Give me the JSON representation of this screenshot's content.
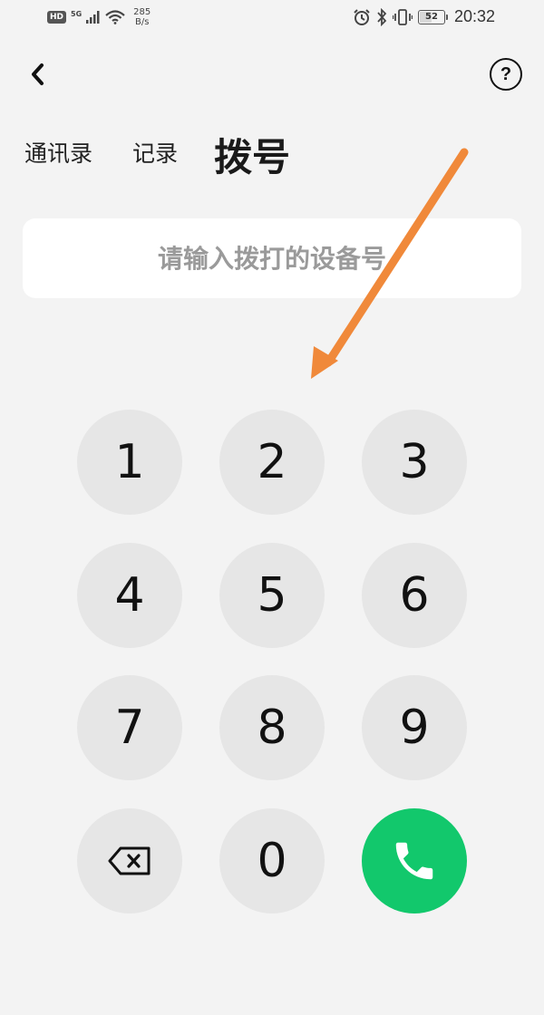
{
  "status_bar": {
    "hd": "HD",
    "network": "5G",
    "speed_value": "285",
    "speed_unit": "B/s",
    "battery_level": "52",
    "battery_fraction": 0.52,
    "time": "20:32",
    "icons": [
      "signal-icon",
      "wifi-icon",
      "alarm-icon",
      "bluetooth-icon",
      "vibrate-icon"
    ]
  },
  "header": {
    "back_icon": "chevron-left-icon",
    "help_label": "?"
  },
  "tabs": [
    {
      "label": "通讯录",
      "active": false
    },
    {
      "label": "记录",
      "active": false
    },
    {
      "label": "拨号",
      "active": true
    }
  ],
  "input": {
    "value": "",
    "placeholder": "请输入拨打的设备号"
  },
  "keypad": {
    "keys": [
      "1",
      "2",
      "3",
      "4",
      "5",
      "6",
      "7",
      "8",
      "9",
      "0"
    ],
    "delete_icon": "backspace-icon",
    "call_icon": "phone-icon",
    "call_color": "#12c86c"
  },
  "annotation": {
    "arrow_color": "#f0893a"
  }
}
